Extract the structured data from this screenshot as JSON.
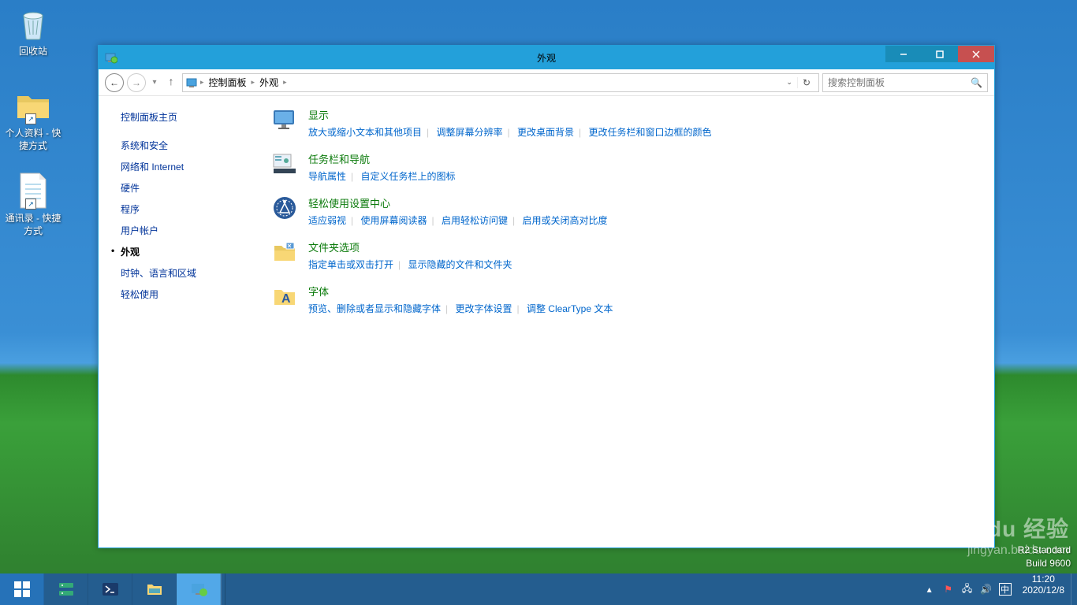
{
  "desktop": {
    "icons": [
      {
        "label": "回收站"
      },
      {
        "label": "个人资料 - 快捷方式"
      },
      {
        "label": "通讯录 - 快捷方式"
      }
    ]
  },
  "window": {
    "title": "外观",
    "breadcrumb": {
      "root_tip": "",
      "seg1": "控制面板",
      "seg2": "外观"
    },
    "search_placeholder": "搜索控制面板"
  },
  "sidebar": {
    "head": "控制面板主页",
    "items": [
      {
        "label": "系统和安全"
      },
      {
        "label": "网络和 Internet"
      },
      {
        "label": "硬件"
      },
      {
        "label": "程序"
      },
      {
        "label": "用户帐户"
      },
      {
        "label": "外观",
        "active": true
      },
      {
        "label": "时钟、语言和区域"
      },
      {
        "label": "轻松使用"
      }
    ]
  },
  "categories": [
    {
      "title": "显示",
      "links": [
        "放大或缩小文本和其他项目",
        "调整屏幕分辨率",
        "更改桌面背景",
        "更改任务栏和窗口边框的颜色"
      ]
    },
    {
      "title": "任务栏和导航",
      "links": [
        "导航属性",
        "自定义任务栏上的图标"
      ]
    },
    {
      "title": "轻松使用设置中心",
      "links": [
        "适应弱视",
        "使用屏幕阅读器",
        "启用轻松访问键",
        "启用或关闭高对比度"
      ]
    },
    {
      "title": "文件夹选项",
      "links": [
        "指定单击或双击打开",
        "显示隐藏的文件和文件夹"
      ]
    },
    {
      "title": "字体",
      "links": [
        "预览、删除或者显示和隐藏字体",
        "更改字体设置",
        "调整 ClearType 文本"
      ]
    }
  ],
  "build": {
    "line1": "R2 Standard",
    "line2": "Build 9600"
  },
  "watermark": {
    "brand": "Baidu 经验",
    "url": "jingyan.baidu.com"
  },
  "taskbar": {
    "clock": {
      "time": "11:20",
      "date": "2020/12/8"
    },
    "ime": "中"
  }
}
